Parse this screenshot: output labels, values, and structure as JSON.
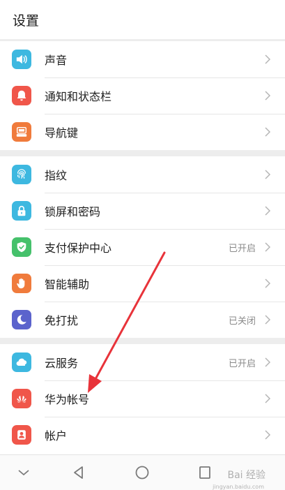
{
  "header": {
    "title": "设置"
  },
  "groups": [
    {
      "items": [
        {
          "label": "声音",
          "icon": "sound-icon",
          "color": "#3db8e0",
          "status": ""
        },
        {
          "label": "通知和状态栏",
          "icon": "bell-icon",
          "color": "#f0564a",
          "status": ""
        },
        {
          "label": "导航键",
          "icon": "navigation-key-icon",
          "color": "#f07b3c",
          "status": ""
        }
      ]
    },
    {
      "items": [
        {
          "label": "指纹",
          "icon": "fingerprint-icon",
          "color": "#3db8e0",
          "status": ""
        },
        {
          "label": "锁屏和密码",
          "icon": "lock-icon",
          "color": "#3db8e0",
          "status": ""
        },
        {
          "label": "支付保护中心",
          "icon": "shield-icon",
          "color": "#45c16b",
          "status": "已开启"
        },
        {
          "label": "智能辅助",
          "icon": "hand-icon",
          "color": "#f07b3c",
          "status": ""
        },
        {
          "label": "免打扰",
          "icon": "moon-icon",
          "color": "#5b63cc",
          "status": "已关闭"
        }
      ]
    },
    {
      "items": [
        {
          "label": "云服务",
          "icon": "cloud-icon",
          "color": "#3db8e0",
          "status": "已开启"
        },
        {
          "label": "华为帐号",
          "icon": "huawei-logo-icon",
          "color": "#f0564a",
          "status": ""
        },
        {
          "label": "帐户",
          "icon": "account-icon",
          "color": "#f0564a",
          "status": ""
        }
      ]
    }
  ],
  "navbar": {
    "buttons": [
      "hide-navbar-icon",
      "back-icon",
      "home-icon",
      "recents-icon"
    ]
  },
  "watermark": {
    "text": "Bai 经验",
    "sub": "jingyan.baidu.com"
  },
  "annotation": {
    "arrow_color": "#e8333a"
  }
}
